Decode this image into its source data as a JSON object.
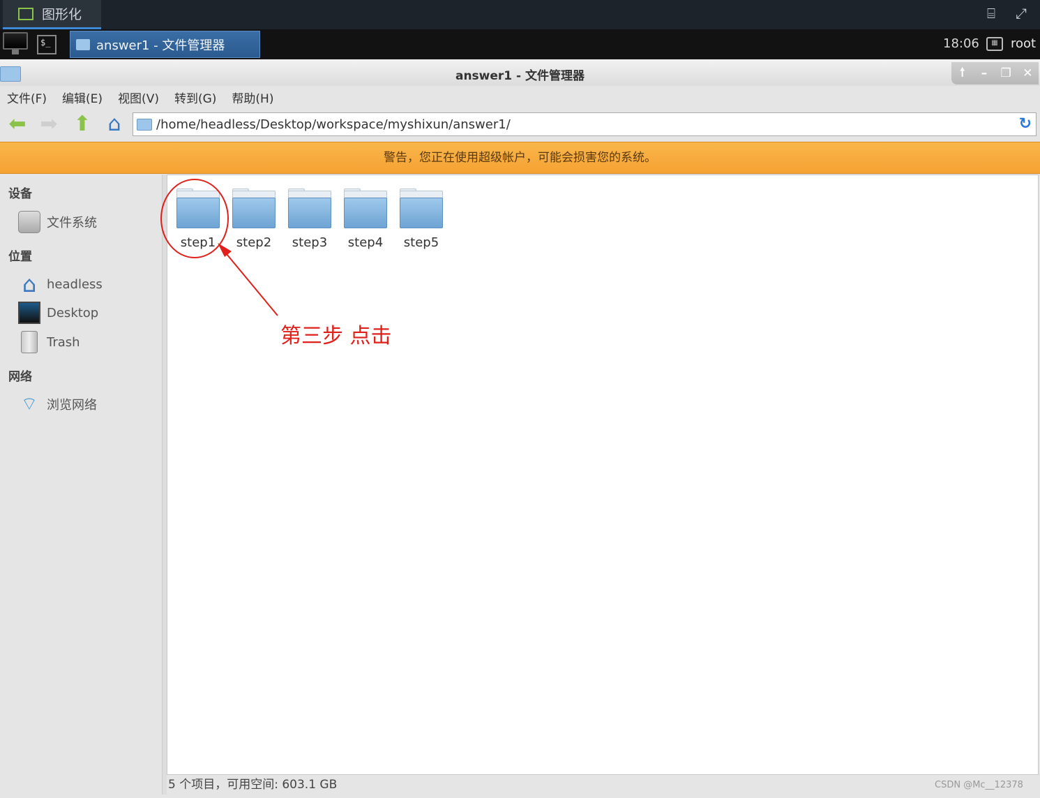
{
  "app_tab": {
    "label": "图形化"
  },
  "taskbar": {
    "task_label": "answer1 - 文件管理器",
    "clock": "18:06",
    "user": "root",
    "terminal_glyph": "$_"
  },
  "window": {
    "title": "answer1 - 文件管理器",
    "controls": {
      "up": "🠕",
      "minimize": "–",
      "restore": "❐",
      "close": "✕"
    }
  },
  "menu": {
    "items": [
      "文件(F)",
      "编辑(E)",
      "视图(V)",
      "转到(G)",
      "帮助(H)"
    ]
  },
  "toolbar": {
    "address": "/home/headless/Desktop/workspace/myshixun/answer1/"
  },
  "warning": "警告，您正在使用超级帐户，可能会损害您的系统。",
  "sidebar": {
    "sections": [
      {
        "heading": "设备",
        "items": [
          {
            "label": "文件系统",
            "icon": "drive-icon"
          }
        ]
      },
      {
        "heading": "位置",
        "items": [
          {
            "label": "headless",
            "icon": "home-icon"
          },
          {
            "label": "Desktop",
            "icon": "desktop-icon"
          },
          {
            "label": "Trash",
            "icon": "trash-icon"
          }
        ]
      },
      {
        "heading": "网络",
        "items": [
          {
            "label": "浏览网络",
            "icon": "wifi-icon"
          }
        ]
      }
    ]
  },
  "files": [
    "step1",
    "step2",
    "step3",
    "step4",
    "step5"
  ],
  "status": "5 个项目，可用空间: 603.1 GB",
  "annotation": {
    "text": "第三步 点击",
    "color": "#e0201a"
  },
  "watermark": "CSDN @Mc__12378"
}
